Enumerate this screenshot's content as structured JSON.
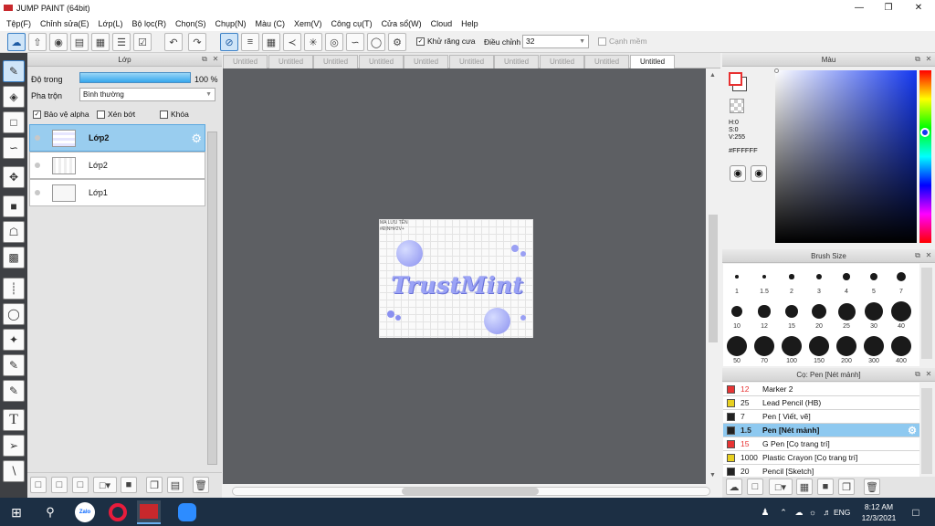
{
  "window": {
    "title": "JUMP PAINT (64bit)"
  },
  "menu": [
    "Tệp(F)",
    "Chỉnh sửa(E)",
    "Lớp(L)",
    "Bộ lọc(R)",
    "Chọn(S)",
    "Chụp(N)",
    "Màu (C)",
    "Xem(V)",
    "Công cụ(T)",
    "Cửa sổ(W)",
    "Cloud",
    "Help"
  ],
  "toolbar": {
    "antialias_label": "Khử răng cưa",
    "adjust_label": "Điều chỉnh",
    "adjust_value": "32",
    "snap_label": "Cạnh mềm"
  },
  "layers_panel": {
    "title": "Lớp",
    "opacity_label": "Độ trong",
    "opacity_value": "100 %",
    "blend_label": "Pha trộn",
    "blend_value": "Bình thường",
    "protect_alpha": "Bảo vệ alpha",
    "clip": "Xén bớt",
    "lock": "Khóa",
    "layers": [
      {
        "name": "Lớp2",
        "selected": true
      },
      {
        "name": "Lớp2",
        "selected": false
      },
      {
        "name": "Lớp1",
        "selected": false
      }
    ]
  },
  "tabs": [
    "Untitled",
    "Untitled",
    "Untitled",
    "Untitled",
    "Untitled",
    "Untitled",
    "Untitled",
    "Untitled",
    "Untitled",
    "Untitled"
  ],
  "canvas": {
    "artwork_text": "TrustMint",
    "corner_text_1": "MA LƯU TÊN",
    "corner_text_2": "#ĐỊNH#2V+"
  },
  "color_panel": {
    "title": "Màu",
    "h": "H:0",
    "s": "S:0",
    "v": "V:255",
    "hex": "#FFFFFF",
    "primary": "#ffffff",
    "secondary": "#e83030"
  },
  "brush_size_panel": {
    "title": "Brush Size",
    "sizes": [
      "1",
      "1.5",
      "2",
      "3",
      "4",
      "5",
      "7",
      "10",
      "12",
      "15",
      "20",
      "25",
      "30",
      "40",
      "50",
      "70",
      "100",
      "150",
      "200",
      "300",
      "400"
    ]
  },
  "brush_panel": {
    "title": "Cọ: Pen [Nét mảnh]",
    "items": [
      {
        "size": "12",
        "name": "Marker 2",
        "color": "#e83434",
        "selected": false
      },
      {
        "size": "25",
        "name": "Lead Pencil (HB)",
        "color": "#e8d020",
        "selected": false
      },
      {
        "size": "7",
        "name": "Pen [ Viết, vẽ]",
        "color": "#222222",
        "selected": false
      },
      {
        "size": "1.5",
        "name": "Pen [Nét mảnh]",
        "color": "#222222",
        "selected": true
      },
      {
        "size": "15",
        "name": "G Pen [Cọ trang trí]",
        "color": "#e83434",
        "selected": false
      },
      {
        "size": "1000",
        "name": "Plastic Crayon [Cọ trang trí]",
        "color": "#e8d020",
        "selected": false
      },
      {
        "size": "20",
        "name": "Pencil [Sketch]",
        "color": "#222222",
        "selected": false
      }
    ]
  },
  "taskbar": {
    "time": "8:12 AM",
    "date": "12/3/2021",
    "lang": "ENG",
    "zalo_label": "Zalo"
  }
}
